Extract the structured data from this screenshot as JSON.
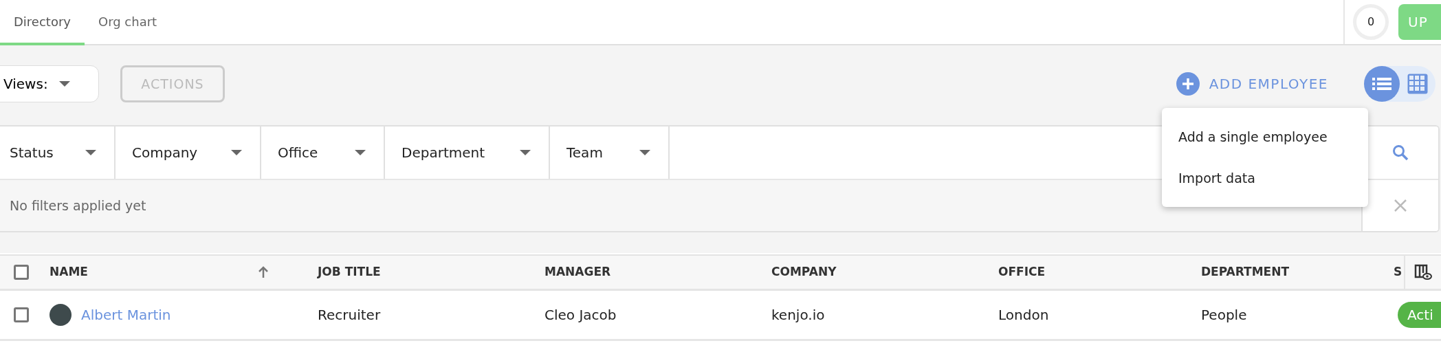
{
  "tabs": [
    {
      "label": "Directory",
      "selected": true
    },
    {
      "label": "Org chart",
      "selected": false
    }
  ],
  "header": {
    "notification_count": "0",
    "upgrade_button": "UP"
  },
  "toolbar": {
    "views_label": "Views:",
    "actions_button": {
      "label": "ACTIONS",
      "disabled": true
    },
    "add_button": "ADD EMPLOYEE",
    "view_modes": [
      {
        "kind": "list",
        "selected": true
      },
      {
        "kind": "grid",
        "selected": false
      }
    ]
  },
  "add_menu": {
    "items": [
      "Add a single employee",
      "Import data"
    ]
  },
  "filters": {
    "dropdowns": [
      "Status",
      "Company",
      "Office",
      "Department",
      "Team"
    ],
    "summary": "No filters applied yet"
  },
  "table": {
    "header_checked": false,
    "columns": [
      {
        "label": "NAME",
        "sorted": true
      },
      {
        "label": "JOB TITLE",
        "sorted": false
      },
      {
        "label": "MANAGER",
        "sorted": false
      },
      {
        "label": "COMPANY",
        "sorted": false
      },
      {
        "label": "OFFICE",
        "sorted": false
      },
      {
        "label": "DEPARTMENT",
        "sorted": false
      },
      {
        "label": "S",
        "sorted": false
      }
    ],
    "rows": [
      {
        "checked": false,
        "name": "Albert Martin",
        "job_title": "Recruiter",
        "manager": "Cleo Jacob",
        "company": "kenjo.io",
        "office": "London",
        "department": "People",
        "status": "Acti"
      }
    ]
  }
}
